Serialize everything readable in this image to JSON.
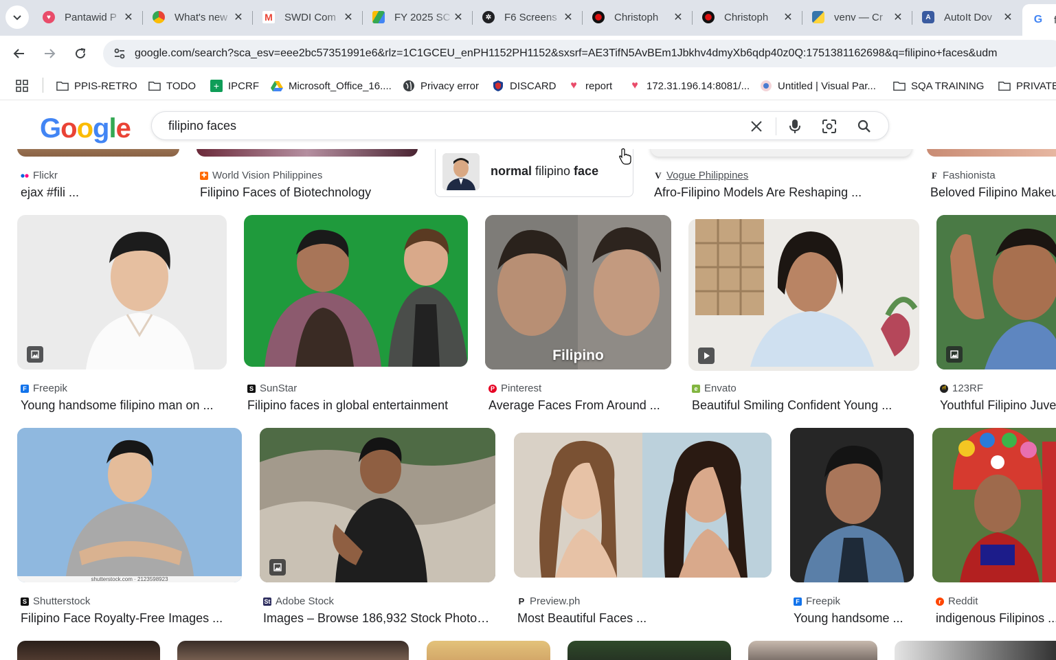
{
  "tabs": [
    {
      "label": "Pantawid P",
      "icon": "heart-favicon"
    },
    {
      "label": "What's new",
      "icon": "chrome-favicon"
    },
    {
      "label": "SWDI Com",
      "icon": "gmail-favicon"
    },
    {
      "label": "FY 2025 SC",
      "icon": "drive-favicon"
    },
    {
      "label": "F6 Screens",
      "icon": "openai-favicon"
    },
    {
      "label": "Christoph",
      "icon": "red-logo-favicon"
    },
    {
      "label": "Christoph",
      "icon": "red-logo-favicon"
    },
    {
      "label": "venv — Cr",
      "icon": "python-favicon"
    },
    {
      "label": "AutoIt Dov",
      "icon": "autoit-favicon"
    },
    {
      "label": "fi",
      "icon": "google-favicon"
    }
  ],
  "address": {
    "url": "google.com/search?sca_esv=eee2bc57351991e6&rlz=1C1GCEU_enPH1152PH1152&sxsrf=AE3TifN5AvBEm1Jbkhv4dmyXb6qdp40z0Q:1751381162698&q=filipino+faces&udm"
  },
  "bookmarks": [
    {
      "label": "PPIS-RETRO",
      "icon": "folder-icon"
    },
    {
      "label": "TODO",
      "icon": "folder-icon"
    },
    {
      "label": "IPCRF",
      "icon": "sheets-icon"
    },
    {
      "label": "Microsoft_Office_16....",
      "icon": "drive-icon"
    },
    {
      "label": "Privacy error",
      "icon": "globe-icon"
    },
    {
      "label": "DISCARD",
      "icon": "shield-icon"
    },
    {
      "label": "report",
      "icon": "heart-icon"
    },
    {
      "label": "172.31.196.14:8081/...",
      "icon": "heart-icon"
    },
    {
      "label": "Untitled | Visual Par...",
      "icon": "paradigm-icon"
    },
    {
      "label": "SQA TRAINING",
      "icon": "folder-icon"
    },
    {
      "label": "PRIVATE",
      "icon": "folder-icon"
    }
  ],
  "search": {
    "logo": "Google",
    "query": "filipino faces"
  },
  "suggestion": {
    "bold_prefix": "normal",
    "middle": " filipino ",
    "bold_suffix": "face"
  },
  "row0": [
    {
      "source": "Flickr",
      "title": "ejax #fili ..."
    },
    {
      "source": "World Vision Philippines",
      "title": "Filipino Faces of Biotechnology"
    },
    {
      "source": "Vogue Philippines",
      "title": "Afro-Filipino Models Are Reshaping ..."
    },
    {
      "source": "Fashionista",
      "title": "Beloved Filipino Makeup ..."
    }
  ],
  "row1": [
    {
      "source": "Freepik",
      "title": "Young handsome filipino man on ...",
      "badge": "image-badge-icon"
    },
    {
      "source": "SunStar",
      "title": "Filipino faces in global entertainment"
    },
    {
      "source": "Pinterest",
      "title": "Average Faces From Around ...",
      "overlay": "Filipino"
    },
    {
      "source": "Envato",
      "title": "Beautiful Smiling Confident Young ...",
      "badge": "video-badge-icon"
    },
    {
      "source": "123RF",
      "title": "Youthful Filipino Juvenile ...",
      "badge": "image-badge-icon"
    }
  ],
  "row2": [
    {
      "source": "Shutterstock",
      "title": "Filipino Face Royalty-Free Images ...",
      "watermark": "shutterstock.com · 2123598923"
    },
    {
      "source": "Adobe Stock",
      "title": "Images – Browse 186,932 Stock Photos ...",
      "badge": "image-badge-icon"
    },
    {
      "source": "Preview.ph",
      "title": "Most Beautiful Faces ..."
    },
    {
      "source": "Freepik",
      "title": "Young handsome ..."
    },
    {
      "source": "Reddit",
      "title": "indigenous Filipinos ..."
    }
  ]
}
